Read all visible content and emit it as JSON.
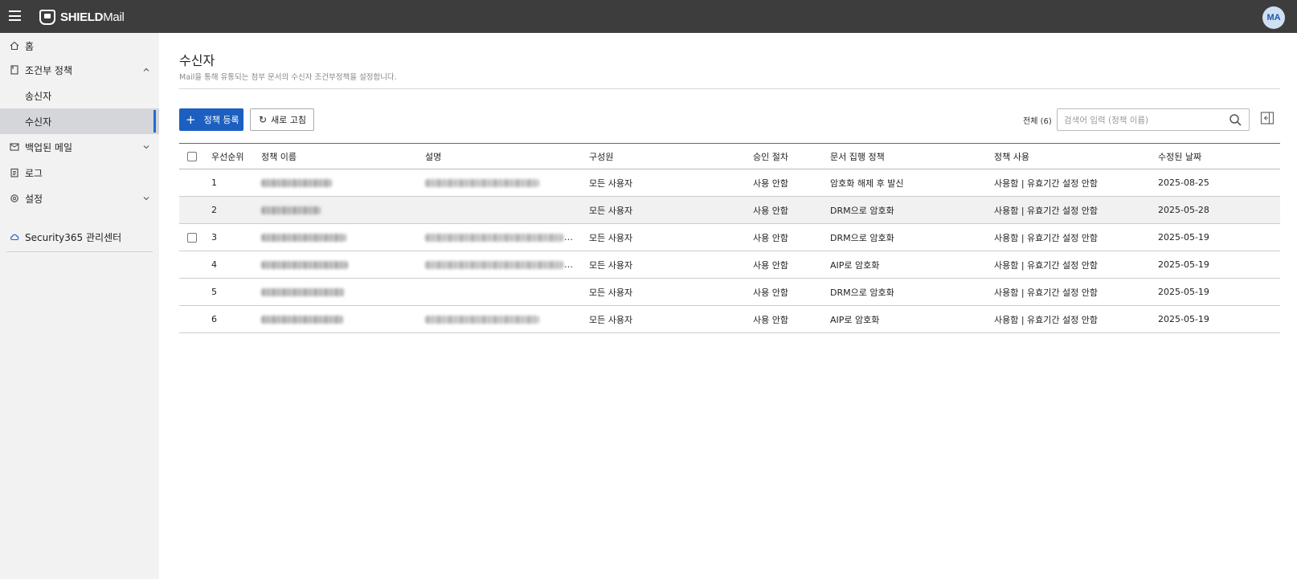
{
  "app": {
    "brand_bold": "SHIELD",
    "brand_rest": "Mail",
    "user_initials": "MA"
  },
  "sidebar": {
    "items": [
      {
        "label": "홈",
        "icon": "home-icon"
      },
      {
        "label": "조건부 정책",
        "icon": "policy-icon",
        "expanded": true
      },
      {
        "label": "송신자"
      },
      {
        "label": "수신자",
        "active": true
      },
      {
        "label": "백업된 메일",
        "icon": "mail-backup-icon"
      },
      {
        "label": "로그",
        "icon": "clipboard-icon"
      },
      {
        "label": "설정",
        "icon": "gear-icon"
      },
      {
        "label": "Security365 관리센터",
        "icon": "cloud-icon"
      }
    ]
  },
  "page": {
    "title": "수신자",
    "description": "Mail을 통해 유통되는 첨부 문서의 수신자 조건부정책을 설정합니다."
  },
  "toolbar": {
    "register_label": "정책 등록",
    "refresh_label": "새로 고침",
    "total_label": "전체 (6)",
    "search_placeholder": "검색어 입력 (정책 이름)"
  },
  "table": {
    "headers": [
      "우선순위",
      "정책 이름",
      "설명",
      "구성원",
      "승인 절차",
      "문서 집행 정책",
      "정책 사용",
      "수정된 날짜"
    ],
    "rows": [
      {
        "priority": "1",
        "members": "모든 사용자",
        "approval": "사용 안함",
        "doc_policy": "암호화 해제 후 발신",
        "usage": "사용함 | 유효기간 설정 안함",
        "modified": "2025-08-25"
      },
      {
        "priority": "2",
        "members": "모든 사용자",
        "approval": "사용 안함",
        "doc_policy": "DRM으로 암호화",
        "usage": "사용함 | 유효기간 설정 안함",
        "modified": "2025-05-28"
      },
      {
        "priority": "3",
        "members": "모든 사용자",
        "approval": "사용 안함",
        "doc_policy": "DRM으로 암호화",
        "usage": "사용함 | 유효기간 설정 안함",
        "modified": "2025-05-19"
      },
      {
        "priority": "4",
        "members": "모든 사용자",
        "approval": "사용 안함",
        "doc_policy": "AIP로 암호화",
        "usage": "사용함 | 유효기간 설정 안함",
        "modified": "2025-05-19"
      },
      {
        "priority": "5",
        "members": "모든 사용자",
        "approval": "사용 안함",
        "doc_policy": "DRM으로 암호화",
        "usage": "사용함 | 유효기간 설정 안함",
        "modified": "2025-05-19"
      },
      {
        "priority": "6",
        "members": "모든 사용자",
        "approval": "사용 안함",
        "doc_policy": "AIP로 암호화",
        "usage": "사용함 | 유효기간 설정 안함",
        "modified": "2025-05-19"
      }
    ]
  },
  "colors": {
    "topbar": "#3d3d3d",
    "accent": "#1c5fc0",
    "sidebar_bg": "#f2f2f2",
    "active_item_bg": "#d4d6da"
  }
}
